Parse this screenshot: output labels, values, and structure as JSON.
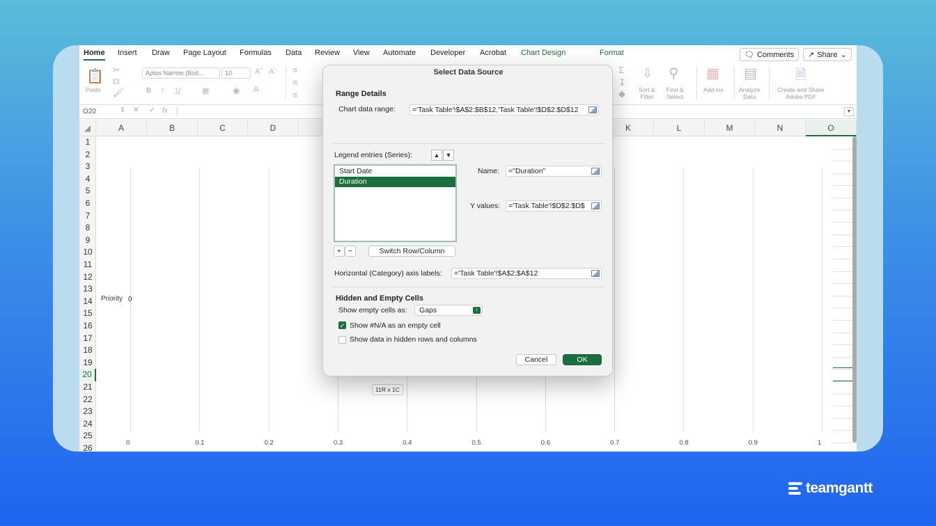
{
  "ribbon_tabs": [
    "Home",
    "Insert",
    "Draw",
    "Page Layout",
    "Formulas",
    "Data",
    "Review",
    "View",
    "Automate",
    "Developer",
    "Acrobat",
    "Chart Design",
    "Format"
  ],
  "top_buttons": {
    "comments": "Comments",
    "share": "Share"
  },
  "ribbon": {
    "paste": "Paste",
    "font_name": "Aptos Narrow (Bod...",
    "font_size": "10",
    "sort_filter_1": "Sort &",
    "sort_filter_2": "Filter",
    "find_select_1": "Find &",
    "find_select_2": "Select",
    "addins": "Add-ins",
    "analyze_1": "Analyze",
    "analyze_2": "Data",
    "adobe_1": "Create and Share",
    "adobe_2": "Adobe PDF"
  },
  "formula_bar": {
    "cell_ref": "O20",
    "fx": "fx"
  },
  "columns": [
    "A",
    "B",
    "C",
    "D",
    "K",
    "L",
    "M",
    "N",
    "O"
  ],
  "rows": [
    "1",
    "2",
    "3",
    "4",
    "5",
    "6",
    "7",
    "8",
    "9",
    "10",
    "11",
    "12",
    "13",
    "14",
    "15",
    "16",
    "17",
    "18",
    "19",
    "20",
    "21",
    "22",
    "23",
    "24",
    "25",
    "26"
  ],
  "selected_column": "O",
  "selected_row": "20",
  "chart": {
    "category_label": "Priority",
    "category_value": "0",
    "x_ticks": [
      "0",
      "0.1",
      "0.2",
      "0.3",
      "0.4",
      "0.5",
      "0.6",
      "0.7",
      "0.8",
      "0.9",
      "1"
    ]
  },
  "selection_tooltip": "11R x 1C",
  "dialog": {
    "title": "Select Data Source",
    "range_details_heading": "Range Details",
    "chart_data_range_label": "Chart data range:",
    "chart_data_range_value": "='Task Table'!$A$2:$B$12,'Task Table'!$D$2:$D$12",
    "legend_entries_label": "Legend entries (Series):",
    "series": [
      "Start Date",
      "Duration"
    ],
    "selected_series": "Duration",
    "name_label": "Name:",
    "name_value": "=\"Duration\"",
    "y_values_label": "Y values:",
    "y_values_value": "='Task Table'!$D$2:$D$",
    "add_btn": "+",
    "remove_btn": "−",
    "switch_btn": "Switch Row/Column",
    "axis_labels_label": "Horizontal (Category) axis labels:",
    "axis_labels_value": "='Task Table'!$A$2:$A$12",
    "hidden_empty_heading": "Hidden and Empty Cells",
    "show_empty_label": "Show empty cells as:",
    "show_empty_value": "Gaps",
    "show_na_label": "Show #N/A as an empty cell",
    "show_na_checked": true,
    "show_hidden_label": "Show data in hidden rows and columns",
    "show_hidden_checked": false,
    "cancel": "Cancel",
    "ok": "OK"
  },
  "brand": "teamgantt",
  "colors": {
    "accent": "#1d6e3f",
    "bg_top": "#5bbcd9",
    "bg_bottom": "#1f64ef"
  }
}
